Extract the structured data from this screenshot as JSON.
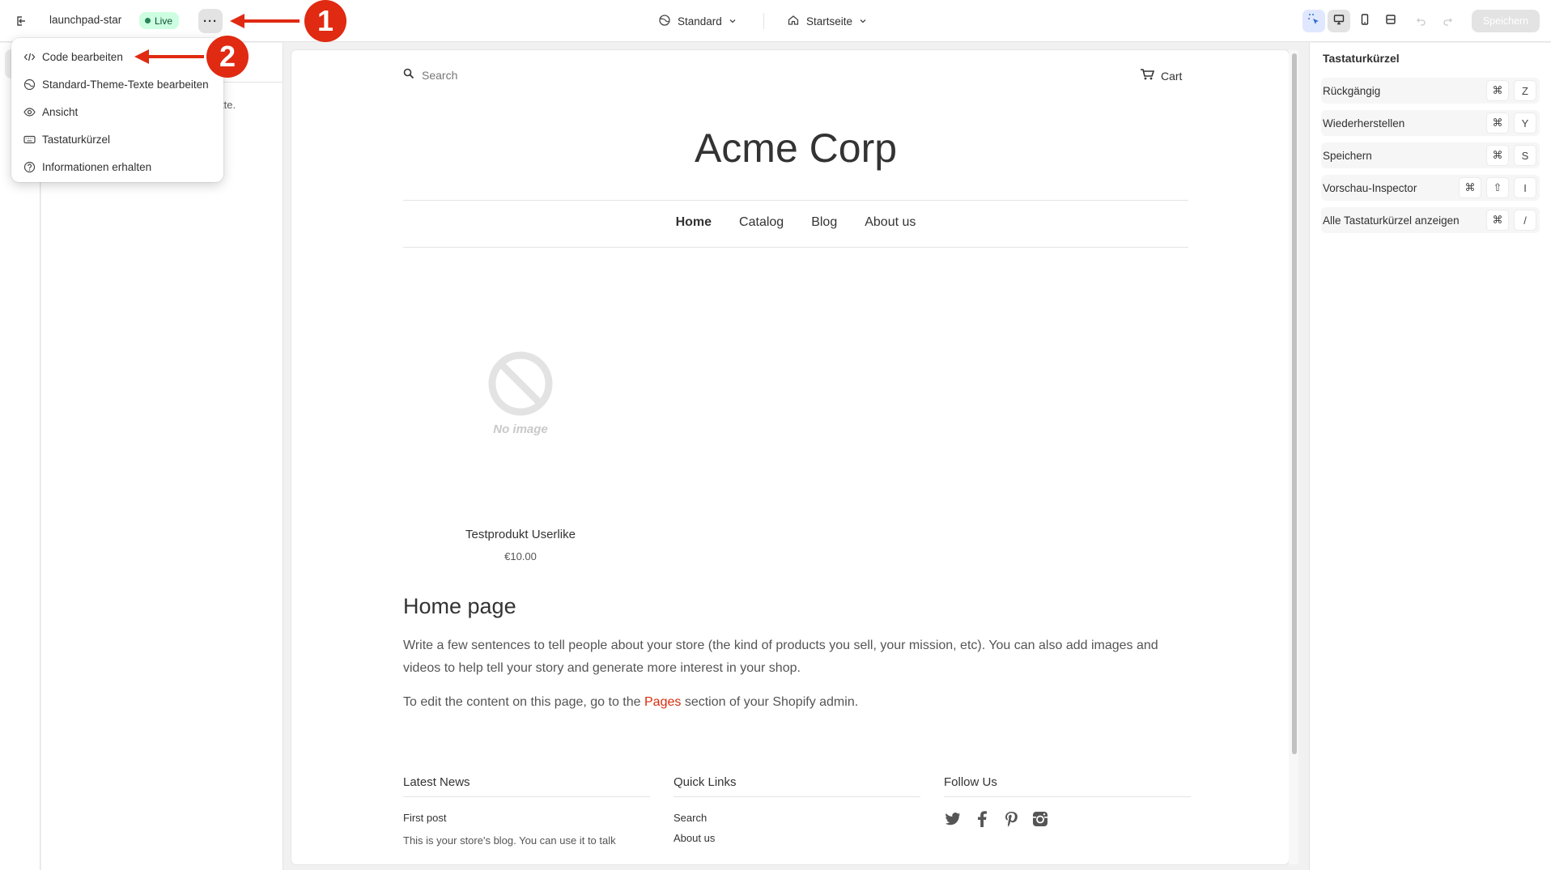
{
  "topbar": {
    "store_name": "launchpad-star",
    "live_label": "Live",
    "more_label": "···",
    "theme_selector": "Standard",
    "page_selector": "Startseite",
    "save_label": "Speichern"
  },
  "left_panel": {
    "partial_text": "tte."
  },
  "more_menu": {
    "items": [
      {
        "label": "Code bearbeiten",
        "icon": "code-icon"
      },
      {
        "label": "Standard-Theme-Texte bearbeiten",
        "icon": "globe-icon"
      },
      {
        "label": "Ansicht",
        "icon": "eye-icon"
      },
      {
        "label": "Tastaturkürzel",
        "icon": "keyboard-icon"
      },
      {
        "label": "Informationen erhalten",
        "icon": "question-icon"
      }
    ]
  },
  "annotations": {
    "callout_1": "1",
    "callout_2": "2",
    "color": "#e02a12"
  },
  "storefront": {
    "search_label": "Search",
    "cart_label": "Cart",
    "logo": "Acme Corp",
    "nav": [
      "Home",
      "Catalog",
      "Blog",
      "About us"
    ],
    "no_image": "No image",
    "product_title": "Testprodukt Userlike",
    "product_price": "€10.00",
    "home_title": "Home page",
    "home_p1": "Write a few sentences to tell people about your store (the kind of products you sell, your mission, etc). You can also add images and videos to help tell your story and generate more interest in your shop.",
    "home_p2_before": "To edit the content on this page, go to the ",
    "home_p2_link": "Pages",
    "home_p2_after": " section of your Shopify admin.",
    "footer": {
      "latest_news_title": "Latest News",
      "first_post": "First post",
      "first_post_text": "This is your store's blog. You can use it to talk",
      "quick_links_title": "Quick Links",
      "quick_links": [
        "Search",
        "About us"
      ],
      "follow_us_title": "Follow Us",
      "social_icons": [
        "twitter-icon",
        "facebook-icon",
        "pinterest-icon",
        "instagram-icon"
      ]
    }
  },
  "shortcuts": {
    "title": "Tastaturkürzel",
    "items": [
      {
        "label": "Rückgängig",
        "keys": [
          "⌘",
          "Z"
        ]
      },
      {
        "label": "Wiederherstellen",
        "keys": [
          "⌘",
          "Y"
        ]
      },
      {
        "label": "Speichern",
        "keys": [
          "⌘",
          "S"
        ]
      },
      {
        "label": "Vorschau-Inspector",
        "keys": [
          "⌘",
          "⇧",
          "I"
        ]
      },
      {
        "label": "Alle Tastaturkürzel anzeigen",
        "keys": [
          "⌘",
          "/"
        ]
      }
    ]
  }
}
